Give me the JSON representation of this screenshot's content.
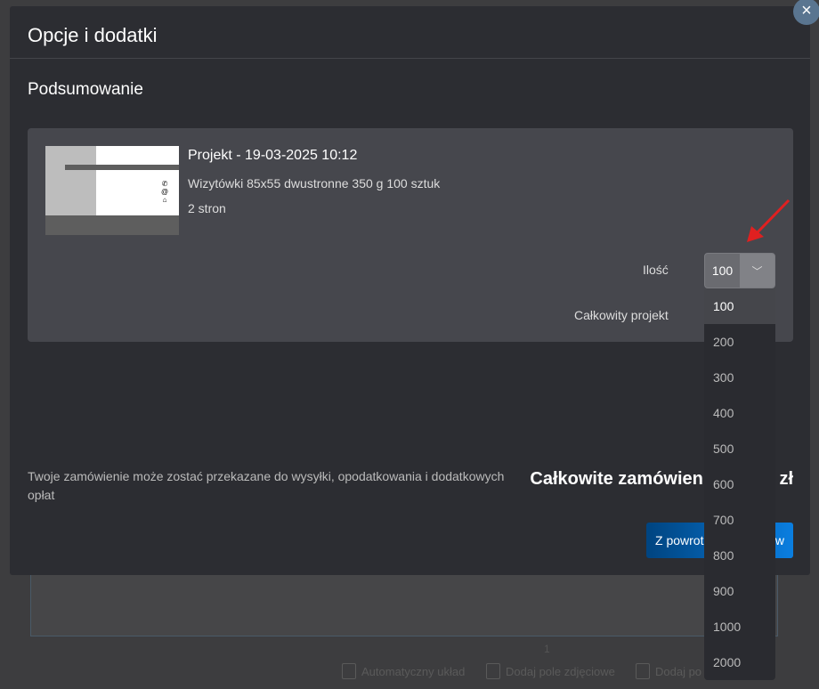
{
  "background": {
    "page_number": "1",
    "tools": [
      "Automatyczny układ",
      "Dodaj pole zdjęciowe",
      "Dodaj po"
    ]
  },
  "modal": {
    "title": "Opcje i dodatki",
    "section_title": "Podsumowanie",
    "project": {
      "title": "Projekt - 19-03-2025 10:12",
      "description": "Wizytówki 85x55 dwustronne 350 g 100 sztuk",
      "pages": "2 stron"
    },
    "quantity": {
      "label": "Ilość",
      "value": "100",
      "options": [
        "100",
        "200",
        "300",
        "400",
        "500",
        "600",
        "700",
        "800",
        "900",
        "1000",
        "2000"
      ]
    },
    "total_project_label": "Całkowity projekt",
    "note": "Twoje zamówienie może zostać przekazane do wysyłki, opodatkowania i dodatkowych opłat",
    "total_order_left": "Całkowite zamówieni",
    "total_order_right": "zł",
    "button_left": "Z powrot",
    "button_right": "w",
    "close_icon": "close-icon"
  },
  "colors": {
    "accent": "#0a7ee0",
    "annotation_arrow": "#e02020"
  }
}
